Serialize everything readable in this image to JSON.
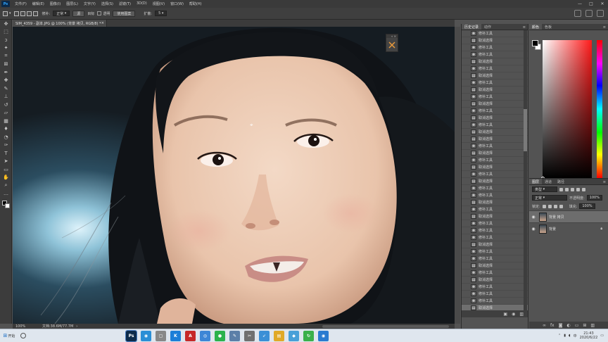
{
  "menubar": {
    "logo": "Ps",
    "items": [
      "文件(F)",
      "编辑(E)",
      "图像(I)",
      "图层(L)",
      "文字(Y)",
      "选择(S)",
      "滤镜(T)",
      "3D(D)",
      "视图(V)",
      "窗口(W)",
      "帮助(H)"
    ],
    "window_buttons": [
      "—",
      "□",
      "✕"
    ]
  },
  "options": {
    "patch_label": "修补:",
    "patch_value": "正常",
    "source_label": "源",
    "target_label": "目标",
    "transparent_label": "透明",
    "use_pattern_label": "使用图案",
    "diffuse_label": "扩散:",
    "diffuse_value": "5"
  },
  "document": {
    "tab_title": "SIM_4359 - 副本.JPG @ 100% (背景 拷贝, RGB/8) *",
    "tab_close": "×",
    "zoom": "100%",
    "doc_info": "文档:38.6M/77.7M"
  },
  "tools": [
    "move",
    "marquee",
    "lasso",
    "magic-wand",
    "crop",
    "frame",
    "eyedropper",
    "healing",
    "brush",
    "stamp",
    "history-brush",
    "eraser",
    "gradient",
    "blur",
    "dodge",
    "pen",
    "text",
    "path-select",
    "shape",
    "hand",
    "zoom",
    "more"
  ],
  "mini_panel": {
    "header": "« ×"
  },
  "history": {
    "tabs": [
      "历史记录",
      "动作"
    ],
    "items": [
      "修补工具",
      "取消选择",
      "修补工具",
      "修补工具",
      "取消选择",
      "修补工具",
      "取消选择",
      "修补工具",
      "取消选择",
      "修补工具",
      "取消选择",
      "修补工具",
      "取消选择",
      "修补工具",
      "取消选择",
      "取消选择",
      "修补工具",
      "取消选择",
      "修补工具",
      "取消选择",
      "修补工具",
      "取消选择",
      "修补工具",
      "修补工具",
      "取消选择",
      "修补工具",
      "取消选择",
      "修补工具",
      "修补工具",
      "修补工具",
      "取消选择",
      "修补工具",
      "修补工具",
      "取消选择",
      "修补工具",
      "取消选择",
      "修补工具",
      "修补工具",
      "修补工具",
      "取消选择"
    ],
    "current_index": 39
  },
  "color": {
    "tabs": [
      "颜色",
      "色板"
    ],
    "foreground": "#000000",
    "background": "#ffffff"
  },
  "layers": {
    "tabs": [
      "图层",
      "通道",
      "路径"
    ],
    "filter_value": "类型",
    "blend_value": "正常",
    "opacity_label": "不透明度:",
    "opacity_value": "100%",
    "lock_label": "锁定:",
    "fill_label": "填充:",
    "fill_value": "100%",
    "items": [
      {
        "name": "背景 拷贝",
        "active": true,
        "locked": false
      },
      {
        "name": "背景",
        "active": false,
        "locked": true
      }
    ]
  },
  "taskbar": {
    "start_label": "开始",
    "time": "21:43",
    "date": "2020/6/22",
    "apps": [
      {
        "name": "photoshop",
        "glyph": "Ps",
        "color": "#0c2a4a"
      },
      {
        "name": "browser",
        "glyph": "◉",
        "color": "#2a8fd6"
      },
      {
        "name": "notes",
        "glyph": "▢",
        "color": "#888888"
      },
      {
        "name": "kugou",
        "glyph": "K",
        "color": "#1c7fd8"
      },
      {
        "name": "acrobat",
        "glyph": "A",
        "color": "#c62828"
      },
      {
        "name": "chrome",
        "glyph": "◎",
        "color": "#3d86d6"
      },
      {
        "name": "wechat",
        "glyph": "●",
        "color": "#2bb24c"
      },
      {
        "name": "paint",
        "glyph": "✎",
        "color": "#5c7fa8"
      },
      {
        "name": "screenshot",
        "glyph": "✂",
        "color": "#707070"
      },
      {
        "name": "bird",
        "glyph": "➶",
        "color": "#3a8fd6"
      },
      {
        "name": "folder",
        "glyph": "▤",
        "color": "#e0a928"
      },
      {
        "name": "chat",
        "glyph": "◆",
        "color": "#48a0d8"
      },
      {
        "name": "refresh",
        "glyph": "↻",
        "color": "#3ab04a"
      },
      {
        "name": "camera",
        "glyph": "◉",
        "color": "#2a7bd0"
      }
    ]
  }
}
